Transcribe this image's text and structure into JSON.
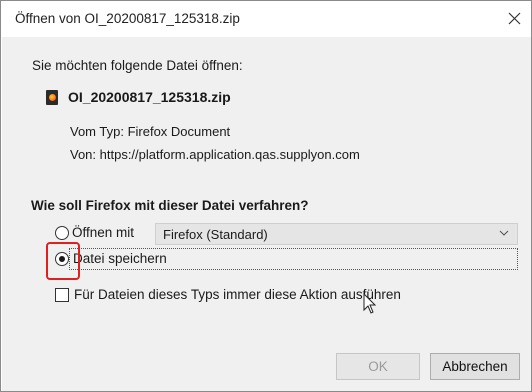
{
  "dialog": {
    "title": "Öffnen von OI_20200817_125318.zip",
    "intro": "Sie möchten folgende Datei öffnen:",
    "file_name": "OI_20200817_125318.zip",
    "file_type": "Vom Typ: Firefox Document",
    "file_source": "Von: https://platform.application.qas.supplyon.com",
    "question": "Wie soll Firefox mit dieser Datei verfahren?",
    "options": {
      "open_label": "Öffnen mit",
      "open_app": "Firefox (Standard)",
      "save_label": "Datei speichern",
      "save_selected": true,
      "always_label": "Für Dateien dieses Typs immer diese Aktion ausführen",
      "always_checked": false
    },
    "buttons": {
      "ok": "OK",
      "cancel": "Abbrechen"
    }
  },
  "colors": {
    "highlight": "#e02020",
    "dialog_bg": "#f0f0f0"
  }
}
